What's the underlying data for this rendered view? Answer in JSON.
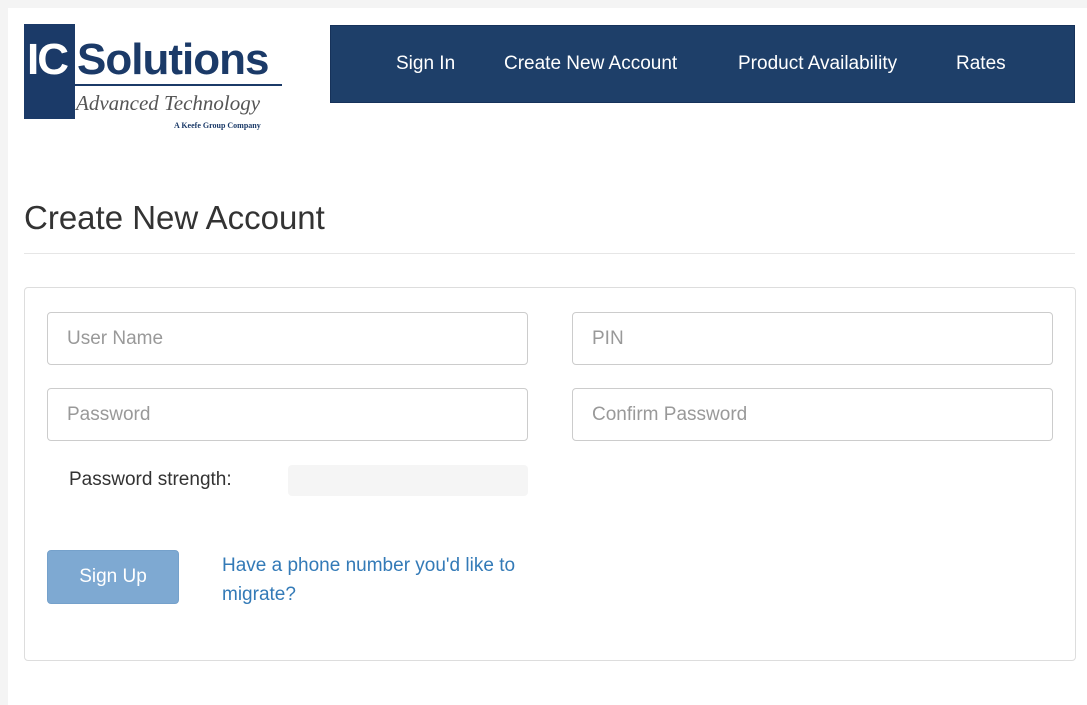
{
  "logo": {
    "ic": "IC",
    "name": "Solutions",
    "tagline": "Advanced Technology",
    "subtag": "A Keefe Group Company"
  },
  "nav": {
    "items": [
      {
        "label": "Sign In"
      },
      {
        "label": "Create New Account"
      },
      {
        "label": "Product Availability"
      },
      {
        "label": "Rates"
      }
    ]
  },
  "page": {
    "title": "Create New Account"
  },
  "form": {
    "username": {
      "placeholder": "User Name",
      "value": ""
    },
    "pin": {
      "placeholder": "PIN",
      "value": ""
    },
    "password": {
      "placeholder": "Password",
      "value": ""
    },
    "confirm_password": {
      "placeholder": "Confirm Password",
      "value": ""
    },
    "password_strength_label": "Password strength:",
    "password_strength_value": 0,
    "signup_label": "Sign Up",
    "migrate_link": "Have a phone number you'd like to migrate?"
  },
  "colors": {
    "brand_navy": "#1e3f69",
    "button_disabled": "#7ea9d2",
    "link": "#337ab7"
  }
}
